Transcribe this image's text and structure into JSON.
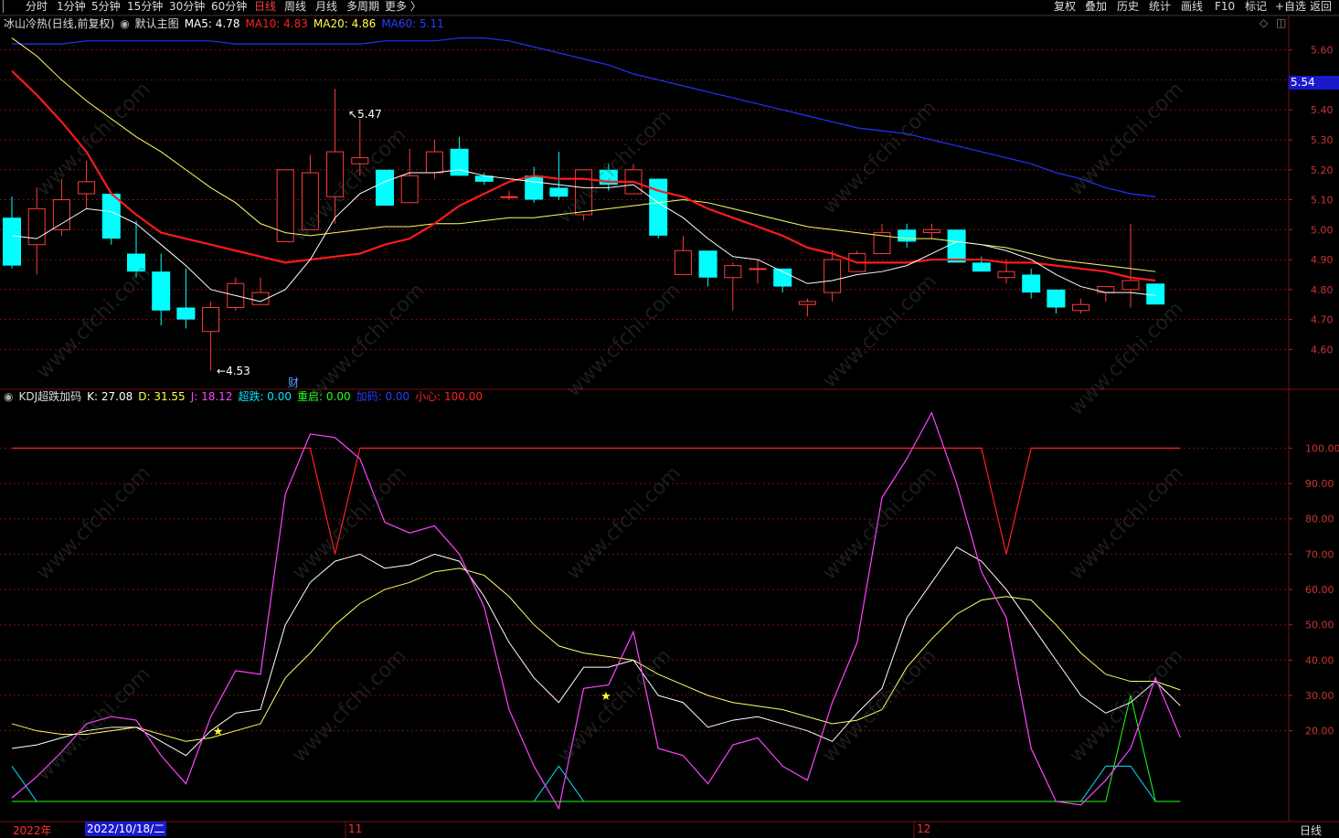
{
  "topbar": {
    "back_icon": "chevron-left-icon",
    "periods": [
      "分时",
      "1分钟",
      "5分钟",
      "15分钟",
      "30分钟",
      "60分钟",
      "日线",
      "周线",
      "月线",
      "多周期",
      "更多 〉"
    ],
    "active_period": "日线",
    "tools": [
      "复权",
      "叠加",
      "历史",
      "统计",
      "画线",
      "F10",
      "标记",
      "+自选",
      "返回"
    ]
  },
  "main_info": {
    "title": "冰山冷热(日线,前复权)",
    "template": "默认主图",
    "ma5": "MA5: 4.78",
    "ma10": "MA10: 4.83",
    "ma20": "MA20: 4.86",
    "ma60": "MA60: 5.11"
  },
  "kdj_info": {
    "title": "KDJ超跌加码",
    "k": "K: 27.08",
    "d": "D: 31.55",
    "j": "J: 18.12",
    "chaodie": "超跌: 0.00",
    "chongqi": "重启: 0.00",
    "jiama": "加码: 0.00",
    "xiaoxin": "小心: 100.00"
  },
  "markers": {
    "high_label": "5.47",
    "low_label": "4.53",
    "cai_label": "财",
    "price_tag": "5.54"
  },
  "bottom": {
    "year": "2022年",
    "cursor_date": "2022/10/18/二",
    "m11": "11",
    "m12": "12",
    "period": "日线"
  },
  "watermark": "www.cfchi.com",
  "colors": {
    "bg": "#000000",
    "up": "#ff3b3b",
    "down": "#00ffff",
    "ma5": "#ffffff",
    "ma10": "#ff1a1a",
    "ma20": "#ffff66",
    "ma60": "#2233ff",
    "j_line": "#ff44ff",
    "grid": "#7a1010"
  },
  "chart_data": [
    {
      "type": "candlestick",
      "title": "冰山冷热(日线,前复权)",
      "y_ticks": [
        "4.60",
        "4.70",
        "4.80",
        "4.90",
        "5.00",
        "5.10",
        "5.20",
        "5.30",
        "5.40",
        "5.50",
        "5.60"
      ],
      "ylim": [
        4.47,
        5.66
      ],
      "candles": [
        {
          "o": 5.04,
          "h": 5.11,
          "l": 4.87,
          "c": 4.88
        },
        {
          "o": 4.95,
          "h": 5.14,
          "l": 4.85,
          "c": 5.07
        },
        {
          "o": 5.0,
          "h": 5.17,
          "l": 4.98,
          "c": 5.1
        },
        {
          "o": 5.12,
          "h": 5.23,
          "l": 5.07,
          "c": 5.16
        },
        {
          "o": 5.12,
          "h": 5.12,
          "l": 4.95,
          "c": 4.97
        },
        {
          "o": 4.92,
          "h": 5.03,
          "l": 4.84,
          "c": 4.86
        },
        {
          "o": 4.86,
          "h": 4.92,
          "l": 4.68,
          "c": 4.73
        },
        {
          "o": 4.74,
          "h": 4.87,
          "l": 4.67,
          "c": 4.7
        },
        {
          "o": 4.66,
          "h": 4.76,
          "l": 4.53,
          "c": 4.74
        },
        {
          "o": 4.74,
          "h": 4.84,
          "l": 4.73,
          "c": 4.82
        },
        {
          "o": 4.75,
          "h": 4.84,
          "l": 4.75,
          "c": 4.79
        },
        {
          "o": 4.96,
          "h": 5.2,
          "l": 4.96,
          "c": 5.2
        },
        {
          "o": 5.0,
          "h": 5.25,
          "l": 5.0,
          "c": 5.19
        },
        {
          "o": 5.11,
          "h": 5.47,
          "l": 5.02,
          "c": 5.26
        },
        {
          "o": 5.22,
          "h": 5.37,
          "l": 5.18,
          "c": 5.24
        },
        {
          "o": 5.2,
          "h": 5.2,
          "l": 5.08,
          "c": 5.08
        },
        {
          "o": 5.09,
          "h": 5.27,
          "l": 5.09,
          "c": 5.18
        },
        {
          "o": 5.19,
          "h": 5.3,
          "l": 5.17,
          "c": 5.26
        },
        {
          "o": 5.27,
          "h": 5.31,
          "l": 5.18,
          "c": 5.18
        },
        {
          "o": 5.18,
          "h": 5.19,
          "l": 5.15,
          "c": 5.16
        },
        {
          "o": 5.11,
          "h": 5.13,
          "l": 5.1,
          "c": 5.11
        },
        {
          "o": 5.18,
          "h": 5.21,
          "l": 5.09,
          "c": 5.1
        },
        {
          "o": 5.14,
          "h": 5.26,
          "l": 5.1,
          "c": 5.11
        },
        {
          "o": 5.05,
          "h": 5.2,
          "l": 5.03,
          "c": 5.2
        },
        {
          "o": 5.2,
          "h": 5.22,
          "l": 5.13,
          "c": 5.15
        },
        {
          "o": 5.12,
          "h": 5.22,
          "l": 5.12,
          "c": 5.2
        },
        {
          "o": 5.17,
          "h": 5.17,
          "l": 4.97,
          "c": 4.98
        },
        {
          "o": 4.85,
          "h": 4.98,
          "l": 4.85,
          "c": 4.93
        },
        {
          "o": 4.93,
          "h": 4.93,
          "l": 4.81,
          "c": 4.84
        },
        {
          "o": 4.84,
          "h": 4.89,
          "l": 4.73,
          "c": 4.88
        },
        {
          "o": 4.87,
          "h": 4.9,
          "l": 4.82,
          "c": 4.87
        },
        {
          "o": 4.87,
          "h": 4.87,
          "l": 4.79,
          "c": 4.81
        },
        {
          "o": 4.75,
          "h": 4.77,
          "l": 4.71,
          "c": 4.76
        },
        {
          "o": 4.79,
          "h": 4.93,
          "l": 4.76,
          "c": 4.9
        },
        {
          "o": 4.86,
          "h": 4.93,
          "l": 4.86,
          "c": 4.92
        },
        {
          "o": 4.92,
          "h": 5.02,
          "l": 4.92,
          "c": 4.99
        },
        {
          "o": 5.0,
          "h": 5.02,
          "l": 4.94,
          "c": 4.96
        },
        {
          "o": 4.99,
          "h": 5.02,
          "l": 4.97,
          "c": 5.0
        },
        {
          "o": 5.0,
          "h": 5.0,
          "l": 4.89,
          "c": 4.89
        },
        {
          "o": 4.89,
          "h": 4.91,
          "l": 4.86,
          "c": 4.86
        },
        {
          "o": 4.84,
          "h": 4.9,
          "l": 4.82,
          "c": 4.86
        },
        {
          "o": 4.85,
          "h": 4.87,
          "l": 4.77,
          "c": 4.79
        },
        {
          "o": 4.8,
          "h": 4.8,
          "l": 4.72,
          "c": 4.74
        },
        {
          "o": 4.73,
          "h": 4.77,
          "l": 4.72,
          "c": 4.75
        },
        {
          "o": 4.79,
          "h": 4.81,
          "l": 4.76,
          "c": 4.81
        },
        {
          "o": 4.8,
          "h": 5.02,
          "l": 4.74,
          "c": 4.83
        },
        {
          "o": 4.82,
          "h": 4.82,
          "l": 4.75,
          "c": 4.75
        }
      ],
      "series": [
        {
          "name": "MA5",
          "values": [
            4.98,
            4.97,
            5.02,
            5.07,
            5.06,
            5.02,
            4.95,
            4.88,
            4.8,
            4.78,
            4.76,
            4.8,
            4.9,
            5.04,
            5.12,
            5.16,
            5.19,
            5.19,
            5.2,
            5.18,
            5.17,
            5.16,
            5.15,
            5.14,
            5.14,
            5.15,
            5.09,
            5.04,
            4.97,
            4.91,
            4.9,
            4.86,
            4.82,
            4.83,
            4.85,
            4.86,
            4.88,
            4.92,
            4.96,
            4.95,
            4.93,
            4.9,
            4.85,
            4.81,
            4.79,
            4.79,
            4.78
          ]
        },
        {
          "name": "MA10",
          "values": [
            5.53,
            5.45,
            5.36,
            5.26,
            5.12,
            5.05,
            4.99,
            4.97,
            4.95,
            4.93,
            4.91,
            4.89,
            4.9,
            4.91,
            4.92,
            4.95,
            4.97,
            5.02,
            5.08,
            5.12,
            5.16,
            5.18,
            5.17,
            5.17,
            5.16,
            5.16,
            5.13,
            5.11,
            5.07,
            5.04,
            5.01,
            4.98,
            4.94,
            4.92,
            4.89,
            4.89,
            4.89,
            4.9,
            4.9,
            4.9,
            4.89,
            4.89,
            4.88,
            4.87,
            4.86,
            4.84,
            4.83
          ]
        },
        {
          "name": "MA20",
          "values": [
            5.64,
            5.58,
            5.5,
            5.43,
            5.37,
            5.31,
            5.26,
            5.2,
            5.14,
            5.09,
            5.02,
            4.99,
            4.98,
            4.99,
            5.0,
            5.01,
            5.01,
            5.02,
            5.02,
            5.03,
            5.04,
            5.04,
            5.05,
            5.06,
            5.07,
            5.08,
            5.09,
            5.1,
            5.09,
            5.07,
            5.05,
            5.03,
            5.01,
            5.0,
            4.99,
            4.98,
            4.97,
            4.97,
            4.96,
            4.95,
            4.94,
            4.92,
            4.9,
            4.89,
            4.88,
            4.87,
            4.86
          ]
        },
        {
          "name": "MA60",
          "values": [
            5.62,
            5.62,
            5.62,
            5.63,
            5.63,
            5.63,
            5.63,
            5.63,
            5.63,
            5.62,
            5.62,
            5.62,
            5.62,
            5.62,
            5.62,
            5.63,
            5.63,
            5.63,
            5.64,
            5.64,
            5.63,
            5.61,
            5.59,
            5.57,
            5.55,
            5.52,
            5.5,
            5.48,
            5.46,
            5.44,
            5.42,
            5.4,
            5.38,
            5.36,
            5.34,
            5.33,
            5.32,
            5.3,
            5.28,
            5.26,
            5.24,
            5.22,
            5.19,
            5.17,
            5.14,
            5.12,
            5.11
          ]
        }
      ]
    },
    {
      "type": "line",
      "title": "KDJ超跌加码",
      "y_ticks": [
        "20.00",
        "30.00",
        "40.00",
        "50.00",
        "60.00",
        "70.00",
        "80.00",
        "90.00",
        "100.00"
      ],
      "ylim": [
        0,
        112
      ],
      "series": [
        {
          "name": "K",
          "values": [
            15,
            16,
            18,
            20,
            21,
            21,
            17,
            13,
            20,
            25,
            26,
            50,
            62,
            68,
            70,
            66,
            67,
            70,
            68,
            58,
            45,
            35,
            28,
            38,
            38,
            40,
            30,
            28,
            21,
            23,
            24,
            22,
            20,
            17,
            25,
            32,
            52,
            62,
            72,
            68,
            60,
            50,
            40,
            30,
            25,
            28,
            34,
            27.08
          ]
        },
        {
          "name": "D",
          "values": [
            22,
            20,
            19,
            19,
            20,
            21,
            19,
            17,
            18,
            20,
            22,
            35,
            42,
            50,
            56,
            60,
            62,
            65,
            66,
            64,
            58,
            50,
            44,
            42,
            41,
            40,
            36,
            33,
            30,
            28,
            27,
            26,
            24,
            22,
            23,
            26,
            38,
            46,
            53,
            57,
            58,
            57,
            50,
            42,
            36,
            34,
            34,
            31.55
          ]
        },
        {
          "name": "J",
          "values": [
            1,
            7,
            14,
            22,
            24,
            23,
            13,
            5,
            24,
            37,
            36,
            87,
            104,
            103,
            97,
            79,
            76,
            78,
            70,
            55,
            26,
            10,
            -2,
            32,
            33,
            48,
            15,
            13,
            5,
            16,
            18,
            10,
            6,
            28,
            45,
            86,
            97,
            110,
            90,
            65,
            52,
            15,
            0,
            -1,
            6,
            15,
            35,
            18.12
          ]
        },
        {
          "name": "小心",
          "values": [
            100,
            100,
            100,
            100,
            100,
            100,
            100,
            100,
            100,
            100,
            100,
            100,
            100,
            70,
            100,
            100,
            100,
            100,
            100,
            100,
            100,
            100,
            100,
            100,
            100,
            100,
            100,
            100,
            100,
            100,
            100,
            100,
            100,
            100,
            100,
            100,
            100,
            100,
            100,
            100,
            70,
            100,
            100,
            100,
            100,
            100,
            100,
            100
          ]
        },
        {
          "name": "超跌",
          "values": [
            10,
            0,
            0,
            0,
            0,
            0,
            0,
            0,
            0,
            0,
            0,
            0,
            0,
            0,
            0,
            0,
            0,
            0,
            0,
            0,
            0,
            0,
            10,
            0,
            0,
            0,
            0,
            0,
            0,
            0,
            0,
            0,
            0,
            0,
            0,
            0,
            0,
            0,
            0,
            0,
            0,
            0,
            0,
            0,
            10,
            10,
            0,
            0
          ]
        },
        {
          "name": "重启",
          "values": [
            0,
            0,
            0,
            0,
            0,
            0,
            0,
            0,
            0,
            0,
            0,
            0,
            0,
            0,
            0,
            0,
            0,
            0,
            0,
            0,
            0,
            0,
            0,
            0,
            0,
            0,
            0,
            0,
            0,
            0,
            0,
            0,
            0,
            0,
            0,
            0,
            0,
            0,
            0,
            0,
            0,
            0,
            0,
            0,
            0,
            30,
            0,
            0
          ]
        }
      ]
    }
  ]
}
